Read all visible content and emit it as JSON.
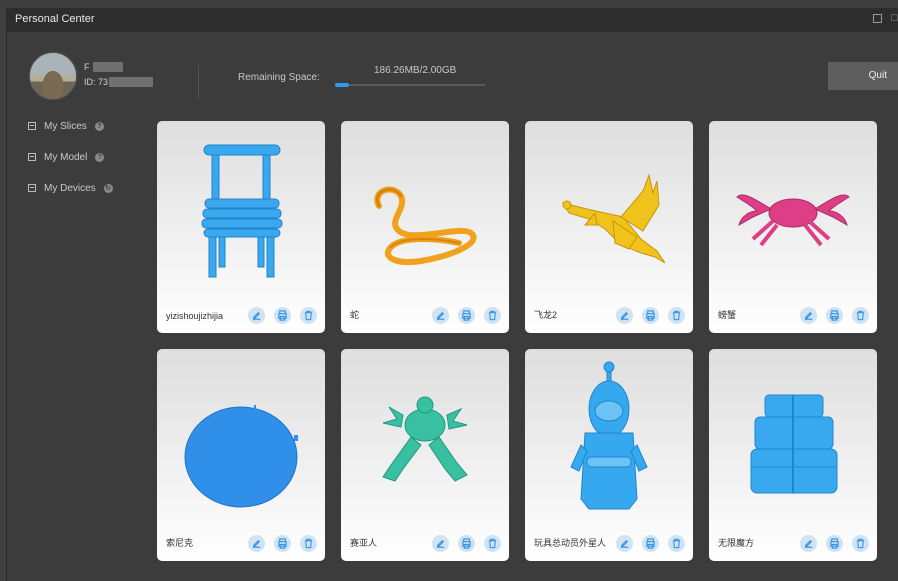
{
  "window": {
    "title": "Personal Center"
  },
  "user": {
    "name": "F",
    "id": "ID: 73"
  },
  "storage": {
    "label": "Remaining Space:",
    "value": "186.26MB/2.00GB",
    "used_fraction": 0.093
  },
  "quit_label": "Quit",
  "sidebar": {
    "items": [
      {
        "label": "My Slices"
      },
      {
        "label": "My Model"
      },
      {
        "label": "My Devices"
      }
    ]
  },
  "models": [
    {
      "name": "yizishoujizhijia",
      "icon": "chair-model",
      "color": "#3aa7ee"
    },
    {
      "name": "蛇",
      "icon": "snake-model",
      "color": "#f0a21c"
    },
    {
      "name": "飞龙2",
      "icon": "dragon-model",
      "color": "#f0c21c"
    },
    {
      "name": "螃蟹",
      "icon": "crab-model",
      "color": "#dd3f86"
    },
    {
      "name": "索尼克",
      "icon": "disc-model",
      "color": "#2f8fe9"
    },
    {
      "name": "赛亚人",
      "icon": "saiyan-model",
      "color": "#39c0a0"
    },
    {
      "name": "玩具总动员外星人",
      "icon": "alien-model",
      "color": "#35a8f0"
    },
    {
      "name": "无限魔方",
      "icon": "infinity-cube-model",
      "color": "#38a9ee"
    }
  ],
  "colors": {
    "accent": "#2d9bf0",
    "action_bg": "#cfe3f4",
    "action_icon": "#2d8fe0"
  }
}
